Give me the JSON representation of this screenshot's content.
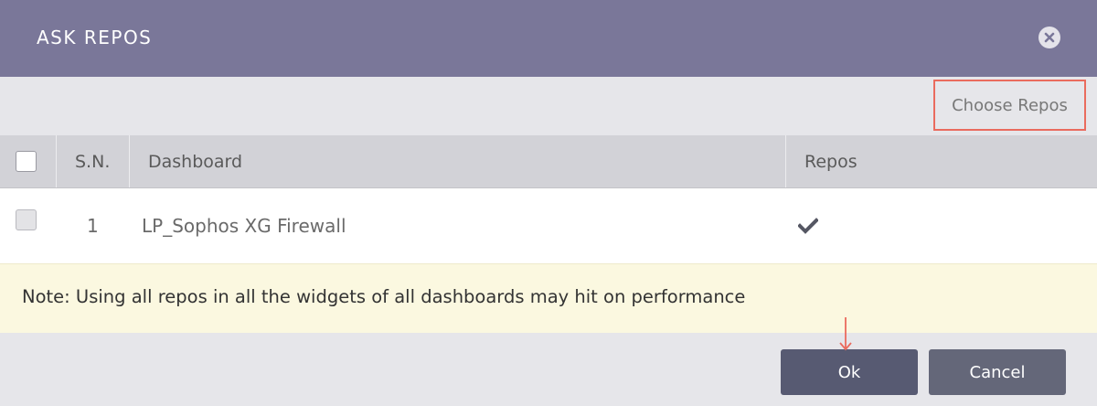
{
  "dialog": {
    "title": "ASK REPOS",
    "close_icon": "close-circle-icon"
  },
  "toolbar": {
    "choose_repos_label": "Choose Repos"
  },
  "table": {
    "columns": [
      "S.N.",
      "Dashboard",
      "Repos"
    ],
    "rows": [
      {
        "sn": "1",
        "dashboard": "LP_Sophos XG Firewall",
        "repos_selected": true,
        "repos_icon": "checkmark-icon"
      }
    ]
  },
  "note": {
    "text": "Note: Using all repos in all the widgets of all dashboards may hit on performance"
  },
  "footer": {
    "ok_label": "Ok",
    "cancel_label": "Cancel"
  },
  "colors": {
    "header": "#7a7799",
    "highlight": "#ea6b5e",
    "note_bg": "#fbf8e0",
    "button": "#575a72"
  }
}
